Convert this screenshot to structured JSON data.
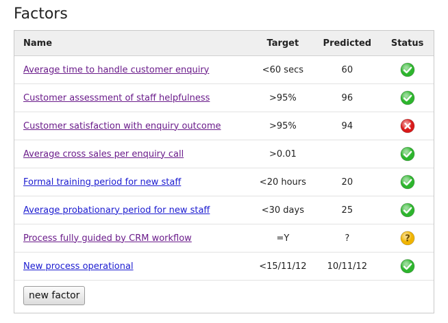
{
  "page": {
    "title": "Factors"
  },
  "table": {
    "headers": {
      "name": "Name",
      "target": "Target",
      "predicted": "Predicted",
      "status": "Status"
    },
    "rows": [
      {
        "name": "Average time to handle customer enquiry",
        "target": "<60 secs",
        "predicted": "60",
        "status": "ok",
        "link_state": "visited"
      },
      {
        "name": "Customer assessment of staff helpfulness",
        "target": ">95%",
        "predicted": "96",
        "status": "ok",
        "link_state": "visited"
      },
      {
        "name": "Customer satisfaction with enquiry outcome",
        "target": ">95%",
        "predicted": "94",
        "status": "fail",
        "link_state": "visited"
      },
      {
        "name": "Average cross sales per enquiry call",
        "target": ">0.01",
        "predicted": "",
        "status": "ok",
        "link_state": "visited"
      },
      {
        "name": "Formal training period for new staff",
        "target": "<20 hours",
        "predicted": "20",
        "status": "ok",
        "link_state": "unvisited"
      },
      {
        "name": "Average probationary period for new staff",
        "target": "<30 days",
        "predicted": "25",
        "status": "ok",
        "link_state": "unvisited"
      },
      {
        "name": "Process fully guided by CRM workflow",
        "target": "=Y",
        "predicted": "?",
        "status": "unknown",
        "link_state": "visited"
      },
      {
        "name": "New process operational",
        "target": "<15/11/12",
        "predicted": "10/11/12",
        "status": "ok",
        "link_state": "unvisited"
      }
    ]
  },
  "actions": {
    "new_factor_label": "new factor"
  },
  "colors": {
    "ok": "#2db52d",
    "fail": "#d91a1a",
    "unknown": "#f0b400",
    "link_visited": "#6a1b8a",
    "link_unvisited": "#1a1ad0"
  },
  "icons": {
    "ok": "check-circle-icon",
    "fail": "x-circle-icon",
    "unknown": "question-circle-icon"
  }
}
